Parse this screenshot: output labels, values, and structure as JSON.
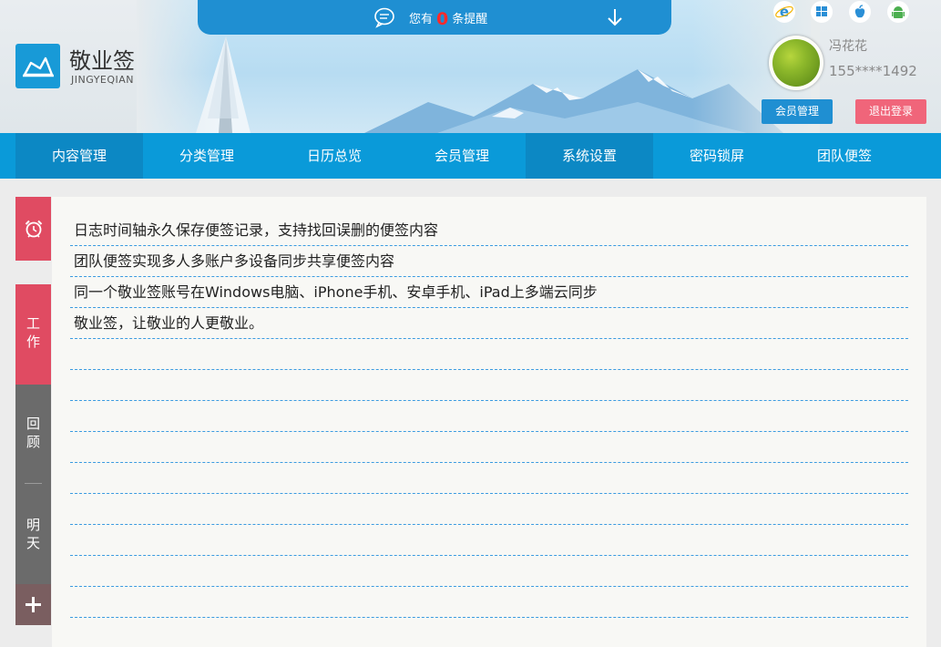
{
  "notice": {
    "prefix": "您有",
    "count": "0",
    "suffix": "条提醒"
  },
  "brand": {
    "name": "敬业签",
    "name_en": "JINGYEQIAN"
  },
  "platforms": [
    {
      "icon": "ie-icon"
    },
    {
      "icon": "windows-icon"
    },
    {
      "icon": "apple-icon"
    },
    {
      "icon": "android-icon"
    }
  ],
  "user": {
    "name": "冯花花",
    "phone": "155****1492"
  },
  "buttons": {
    "member": "会员管理",
    "logout": "退出登录"
  },
  "nav": [
    {
      "label": "内容管理",
      "active": true
    },
    {
      "label": "分类管理",
      "active": false
    },
    {
      "label": "日历总览",
      "active": false
    },
    {
      "label": "会员管理",
      "active": false
    },
    {
      "label": "系统设置",
      "active": true
    },
    {
      "label": "密码锁屏",
      "active": false
    },
    {
      "label": "团队便签",
      "active": false
    }
  ],
  "side": {
    "work": [
      "工",
      "作"
    ],
    "review": [
      "回",
      "顾"
    ],
    "tomorrow": [
      "明",
      "天"
    ]
  },
  "notes": [
    "日志时间轴永久保存便签记录，支持找回误删的便签内容",
    "团队便签实现多人多账户多设备同步共享便签内容",
    "同一个敬业签账号在Windows电脑、iPhone手机、安卓手机、iPad上多端云同步",
    "敬业签，让敬业的人更敬业。",
    "",
    "",
    "",
    "",
    "",
    "",
    "",
    "",
    "",
    ""
  ],
  "colors": {
    "primary": "#0a9ad9",
    "active_nav": "#0c88c4",
    "accent_red": "#e04b62",
    "logout": "#f0657a"
  }
}
